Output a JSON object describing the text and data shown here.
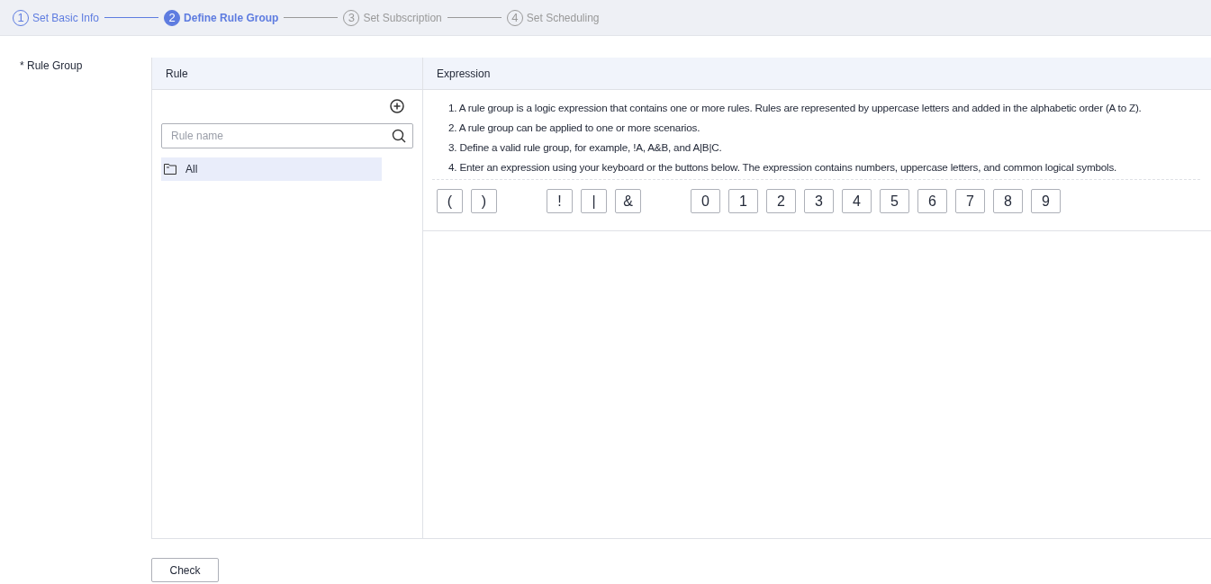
{
  "steps": [
    {
      "number": "1",
      "label": "Set Basic Info",
      "completed": true,
      "selected": false
    },
    {
      "number": "2",
      "label": "Define Rule Group",
      "completed": false,
      "selected": true
    },
    {
      "number": "3",
      "label": "Set Subscription",
      "completed": false,
      "selected": false
    },
    {
      "number": "4",
      "label": "Set Scheduling",
      "completed": false,
      "selected": false
    }
  ],
  "field_label": "* Rule Group",
  "columns": [
    "Rule",
    "Expression"
  ],
  "search": {
    "placeholder": "Rule name"
  },
  "tree": [
    {
      "label": "All",
      "selected": true
    }
  ],
  "instructions": [
    "1. A rule group is a logic expression that contains one or more rules. Rules are represented by uppercase letters and added in the alphabetic order (A to Z).",
    "2. A rule group can be applied to one or more scenarios.",
    "3. Define a valid rule group, for example, !A, A&B, and A|B|C.",
    "4. Enter an expression using your keyboard or the buttons below. The expression contains numbers, uppercase letters, and common logical symbols."
  ],
  "key_groups": [
    [
      "(",
      ")"
    ],
    [
      "!",
      "|",
      "&"
    ],
    [
      "0",
      "1",
      "2",
      "3",
      "4",
      "5",
      "6",
      "7",
      "8",
      "9"
    ]
  ],
  "check_button": "Check"
}
